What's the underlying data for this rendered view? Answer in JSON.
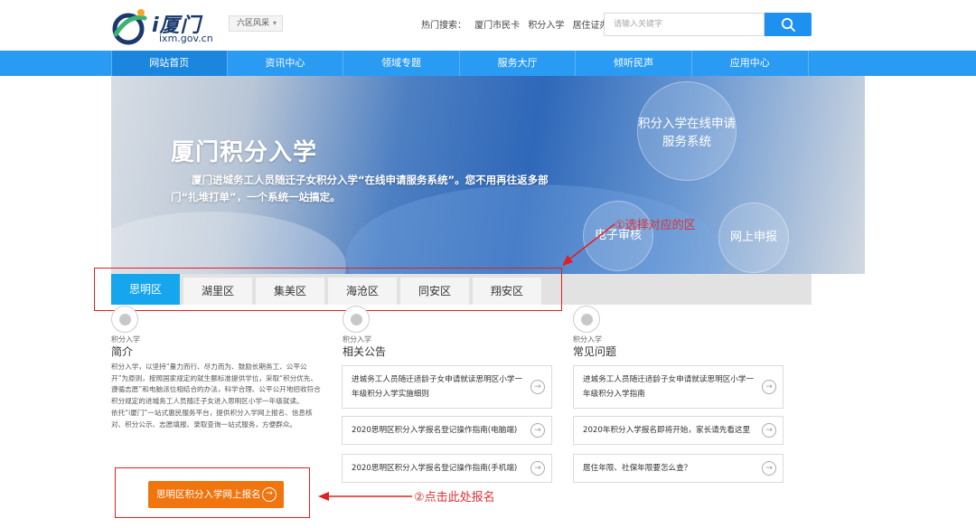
{
  "header": {
    "logo_title": "i厦门",
    "logo_url": "ixm.gov.cn",
    "region_select": "六区风采",
    "hot_label": "热门搜索：",
    "hot_links": [
      "厦门市民卡",
      "积分入学",
      "居住证办理"
    ],
    "search_placeholder": "请输入关键字"
  },
  "nav": {
    "items": [
      "网站首页",
      "资讯中心",
      "领域专题",
      "服务大厅",
      "倾听民声",
      "应用中心"
    ]
  },
  "banner": {
    "title": "厦门积分入学",
    "desc": "厦门进城务工人员随迁子女积分入学“在线申请服务系统”。您不用再往返多部门“扎堆打单”，一个系统一站搞定。",
    "bubble_main": "积分入学在线申请服务系统",
    "bubble_left": "电子审核",
    "bubble_right": "网上申报"
  },
  "annotations": {
    "select_district": "①选择对应的区",
    "click_register": "②点击此处报名"
  },
  "districts": [
    "思明区",
    "湖里区",
    "集美区",
    "海沧区",
    "同安区",
    "翔安区"
  ],
  "intro": {
    "small": "积分入学",
    "head": "简介",
    "p1": "积分入学，以坚持“量力而行、尽力而为、鼓励长期务工、公平公开”为原则，按照国家规定的就生额标准提供学位，采取“积分优先、遵循志愿”和电脑派位相结合的办法，科学合理、公平公开地招收符合积分规定的进城务工人员随迁子女进入思明区小学一年级就读。",
    "p2": "依托“i厦门”一站式惠民服务平台，提供积分入学网上报名、信息核对、积分公示、志愿填报、录取查询一站式服务，方便群众。",
    "register_button": "思明区积分入学网上报名"
  },
  "notices": {
    "small": "积分入学",
    "head": "相关公告",
    "items": [
      "进城务工人员随迁适龄子女申请就读思明区小学一年级积分入学实施细则",
      "2020思明区积分入学报名登记操作指南(电脑端)",
      "2020思明区积分入学报名登记操作指南(手机端)"
    ]
  },
  "faq": {
    "small": "积分入学",
    "head": "常见问题",
    "items": [
      "进城务工人员随迁适龄子女申请就读思明区小学一年级积分入学指南",
      "2020年积分入学报名即将开始，家长请先看这里",
      "居住年限、社保年限要怎么查？"
    ]
  },
  "colors": {
    "nav_blue": "#2a9bf2",
    "tab_active": "#16a6ee",
    "register_orange": "#f0750f",
    "annotation_red": "#e02020"
  }
}
